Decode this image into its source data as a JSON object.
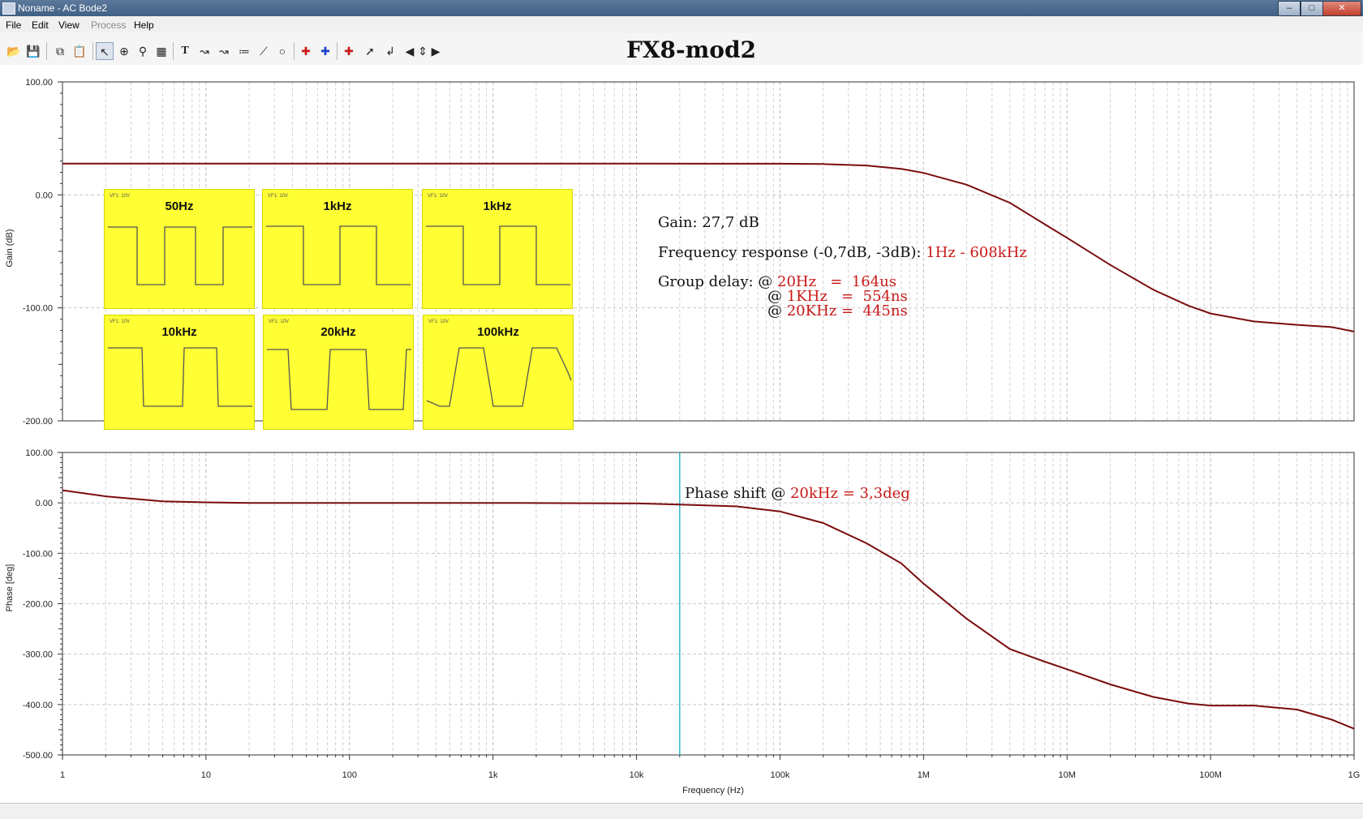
{
  "window": {
    "title": "Noname - AC Bode2",
    "min_glyph": "–",
    "max_glyph": "□",
    "close_glyph": "✕"
  },
  "menu": {
    "file": "File",
    "edit": "Edit",
    "view": "View",
    "process": "Process",
    "help": "Help"
  },
  "toolbar": {
    "icons": [
      "open-icon",
      "save-icon",
      "copy-icon",
      "paste-icon",
      "pointer-icon",
      "zoom-in-icon",
      "zoom-100-icon",
      "grid-icon",
      "text-icon",
      "trace-icon-1",
      "trace-icon-2",
      "trace-icon-3",
      "line-icon",
      "circle-icon",
      "cursor-a-icon",
      "cursor-b-icon",
      "marker-icon",
      "waves-icon",
      "probe-icon",
      "curve-icon",
      "arrow-left-icon",
      "arrow-updown-icon",
      "arrow-right-icon"
    ]
  },
  "page_title": "FX8-mod2",
  "annotations": {
    "gain": "Gain: 27,7 dB",
    "freq_prefix": "Frequency response (-0,7dB, -3dB): ",
    "freq_value": "1Hz - 608kHz",
    "gd_prefix": "Group delay: @ ",
    "gd_20hz": "20Hz   =  164us",
    "gd_1khz_at": "@ ",
    "gd_1khz": "1KHz   =  554ns",
    "gd_20khz_at": "@ ",
    "gd_20khz": "20KHz =  445ns",
    "phase_prefix": "Phase shift @ ",
    "phase_value": "20kHz = 3,3deg"
  },
  "thumbnails": [
    {
      "label": "50Hz",
      "tag": "VF1: 10V"
    },
    {
      "label": "1kHz",
      "tag": "VF1: 10V"
    },
    {
      "label": "1kHz",
      "tag": "VF1: 10V"
    },
    {
      "label": "10kHz",
      "tag": "VF1: 10V"
    },
    {
      "label": "20kHz",
      "tag": "VF1: 10V"
    },
    {
      "label": "100kHz",
      "tag": "VF1: 10V"
    }
  ],
  "colors": {
    "trace": "#7a0c0c",
    "cursor": "#2ab0c8",
    "highlight_text": "#c81818",
    "thumb_bg": "#ffff33"
  },
  "chart_data": [
    {
      "type": "line",
      "title": "",
      "xlabel": "",
      "ylabel": "Gain (dB)",
      "x_scale": "log",
      "xlim": [
        1,
        1000000000
      ],
      "ylim": [
        -200,
        100
      ],
      "yticks": [
        "100.00",
        "0.00",
        "-100.00",
        "-200.00"
      ],
      "grid": true,
      "series": [
        {
          "x": [
            1,
            10,
            100,
            1000,
            10000,
            100000,
            200000,
            400000,
            700000,
            1000000,
            2000000,
            4000000,
            7000000,
            10000000,
            20000000,
            40000000,
            70000000,
            100000000,
            200000000,
            400000000,
            700000000,
            1000000000
          ],
          "values": [
            27.7,
            27.7,
            27.7,
            27.7,
            27.7,
            27.6,
            27.3,
            26,
            23,
            19.5,
            9,
            -7,
            -26,
            -38,
            -62,
            -84,
            -98,
            -105,
            -112,
            -115,
            -117,
            -121
          ]
        }
      ]
    },
    {
      "type": "line",
      "title": "",
      "xlabel": "Frequency (Hz)",
      "ylabel": "Phase [deg]",
      "x_scale": "log",
      "xlim": [
        1,
        1000000000
      ],
      "ylim": [
        -500,
        100
      ],
      "xticks": [
        "1",
        "10",
        "100",
        "1k",
        "10k",
        "100k",
        "1M",
        "10M",
        "100M",
        "1G"
      ],
      "yticks": [
        "100.00",
        "0.00",
        "-100.00",
        "-200.00",
        "-300.00",
        "-400.00",
        "-500.00"
      ],
      "grid": true,
      "cursor_x": 20000,
      "series": [
        {
          "x": [
            1,
            2,
            5,
            10,
            20,
            50,
            100,
            1000,
            10000,
            20000,
            50000,
            100000,
            200000,
            400000,
            700000,
            1000000,
            2000000,
            4000000,
            7000000,
            10000000,
            20000000,
            40000000,
            70000000,
            100000000,
            200000000,
            400000000,
            700000000,
            1000000000
          ],
          "values": [
            25,
            13,
            3,
            1,
            0,
            0,
            0,
            0,
            -1,
            -3.3,
            -7,
            -17,
            -40,
            -80,
            -120,
            -160,
            -230,
            -290,
            -315,
            -330,
            -360,
            -385,
            -398,
            -402,
            -402,
            -410,
            -430,
            -448
          ]
        }
      ]
    }
  ]
}
